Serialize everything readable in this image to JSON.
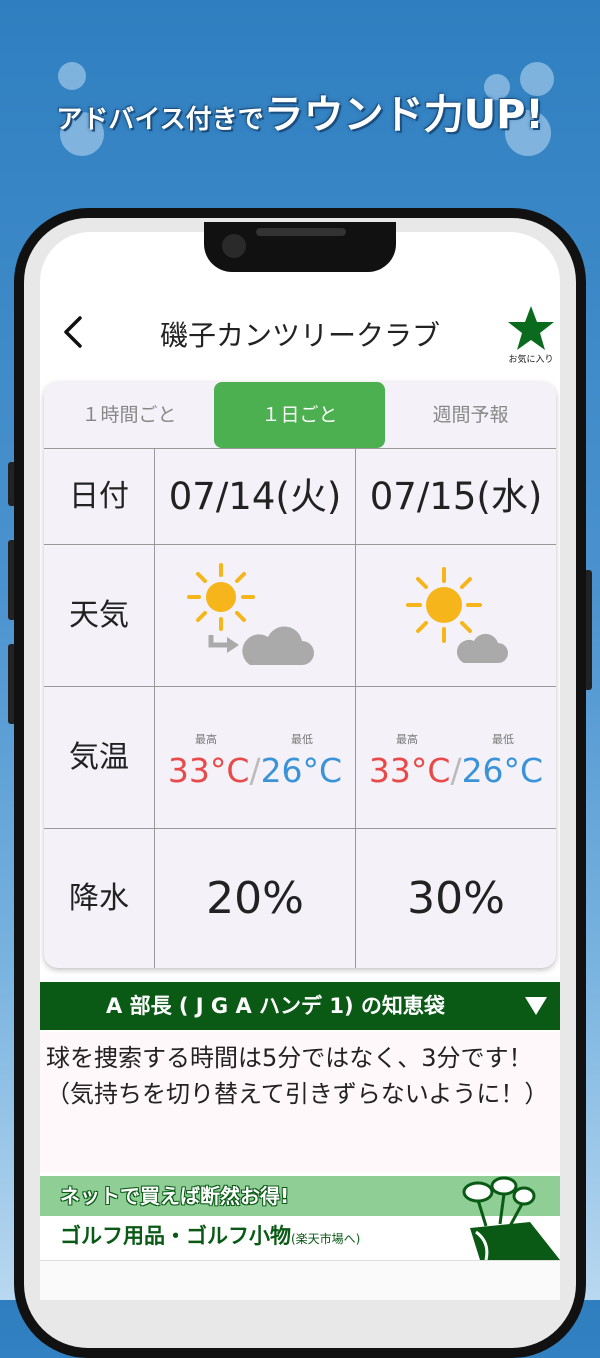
{
  "promo": {
    "headline_small": "アドバイス付きで",
    "headline_big": "ラウンド力UP!"
  },
  "nav": {
    "back_icon": "chevron-left-icon",
    "title": "磯子カンツリークラブ",
    "favorite_label": "お気に入り",
    "favorite_color": "#0a6b1e"
  },
  "tabs": [
    {
      "label": "１時間ごと",
      "active": false
    },
    {
      "label": "１日ごと",
      "active": true
    },
    {
      "label": "週間予報",
      "active": false
    }
  ],
  "forecast": {
    "row_labels": {
      "date": "日付",
      "weather": "天気",
      "temperature": "気温",
      "precipitation": "降水"
    },
    "temp_high_label": "最高",
    "temp_low_label": "最低",
    "temp_separator": "/",
    "days": [
      {
        "date": "07/14(火)",
        "weather_icon": "sun-then-cloudy-icon",
        "high": "33°C",
        "low": "26°C",
        "rain": "20%"
      },
      {
        "date": "07/15(水)",
        "weather_icon": "sun-with-cloud-icon",
        "high": "33°C",
        "low": "26°C",
        "rain": "30%"
      }
    ]
  },
  "tip": {
    "header": "A 部長 ( J G A ハンデ 1) の知恵袋",
    "toggle_icon": "triangle-down-icon",
    "text": "球を捜索する時間は5分ではなく、3分です！（気持ちを切り替えて引きずらないように！）"
  },
  "banner": {
    "line1": "ネットで買えば断然お得!",
    "line2": "ゴルフ用品・ゴルフ小物",
    "line2_small": "(楽天市場へ)",
    "icon": "golf-bag-icon"
  },
  "colors": {
    "accent_green": "#4caf50",
    "dark_green": "#0a5a16",
    "high_temp": "#e84a4a",
    "low_temp": "#3a93d8"
  }
}
